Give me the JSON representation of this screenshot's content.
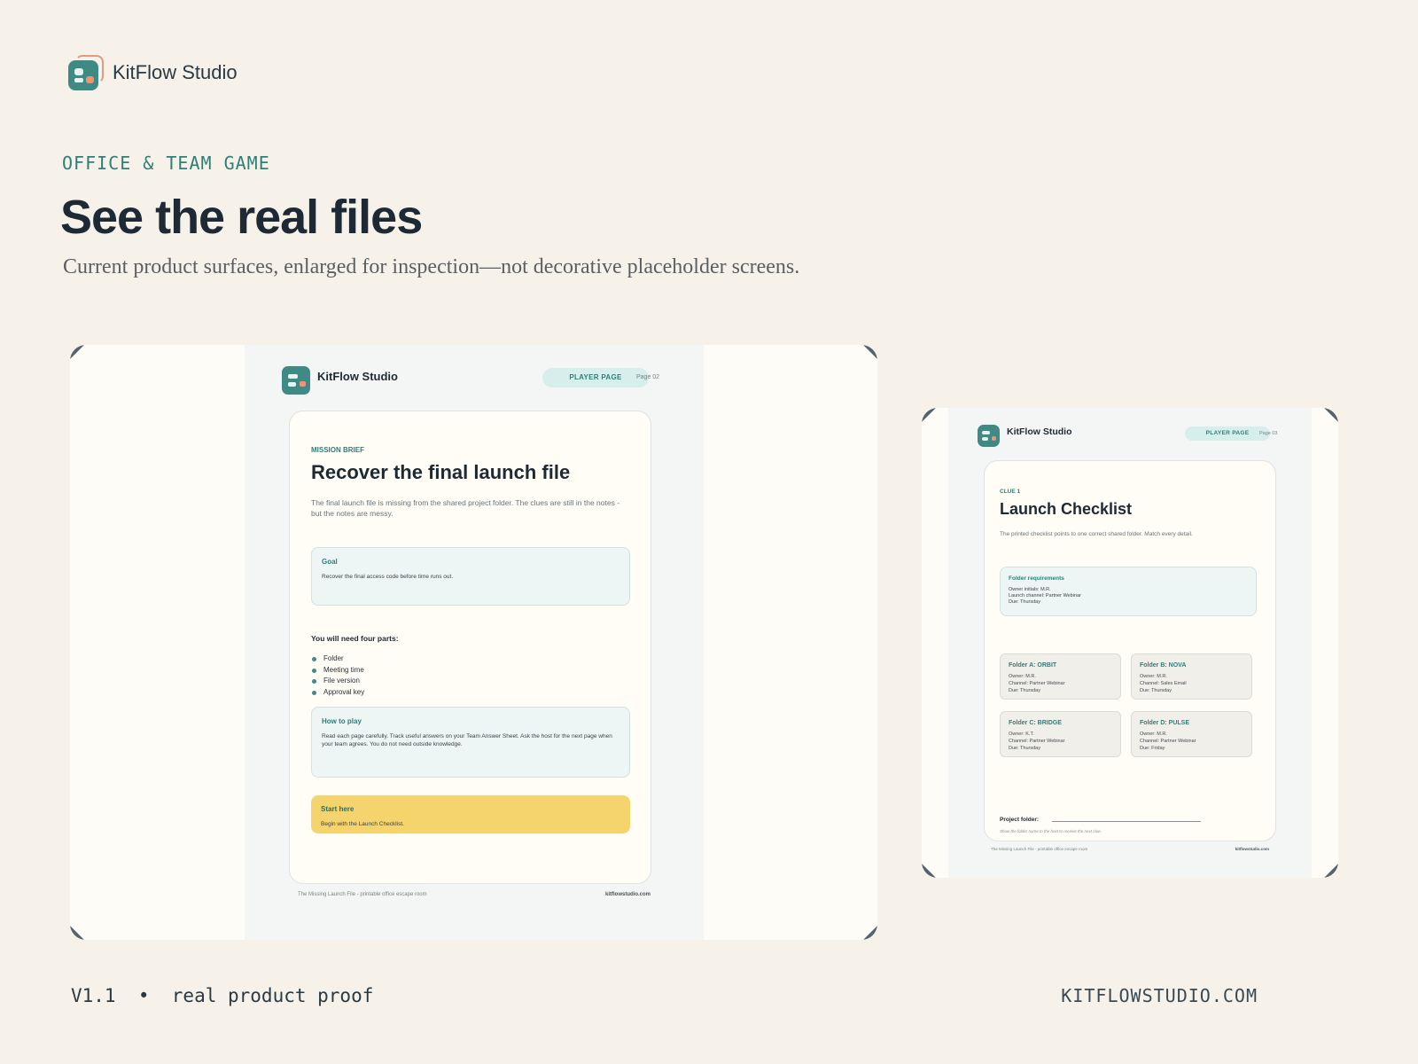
{
  "brand": {
    "name": "KitFlow Studio"
  },
  "eyebrow": "OFFICE & TEAM GAME",
  "headline": "See the real files",
  "subline": "Current product surfaces, enlarged for inspection—not decorative placeholder screens.",
  "page_a": {
    "brand": "KitFlow Studio",
    "pill": "PLAYER PAGE",
    "page_num": "Page 02",
    "kicker": "MISSION BRIEF",
    "title": "Recover the final launch file",
    "desc": "The final launch file is missing from the shared project folder. The clues are still in the notes - but the notes are messy.",
    "goal": {
      "label": "Goal",
      "text": "Recover the final access code before time runs out."
    },
    "parts_title": "You will need four parts:",
    "parts": [
      "Folder",
      "Meeting time",
      "File version",
      "Approval key"
    ],
    "how": {
      "label": "How to play",
      "text": "Read each page carefully. Track useful answers on your Team Answer Sheet. Ask the host for the next page when your team agrees. You do not need outside knowledge."
    },
    "start": {
      "label": "Start here",
      "text": "Begin with the Launch Checklist."
    },
    "footer_left": "The Missing Launch File - printable office escape room",
    "footer_right": "kitflowstudio.com"
  },
  "page_b": {
    "brand": "KitFlow Studio",
    "pill": "PLAYER PAGE",
    "page_num": "Page 03",
    "kicker": "CLUE 1",
    "title": "Launch Checklist",
    "desc": "The printed checklist points to one correct shared folder. Match every detail.",
    "req": {
      "label": "Folder requirements",
      "lines": [
        "Owner initials: M.R.",
        "Launch channel: Partner Webinar",
        "Due: Thursday"
      ]
    },
    "folders": [
      {
        "title": "Folder A: ORBIT",
        "lines": [
          "Owner: M.R.",
          "Channel: Partner Webinar",
          "Due: Thursday"
        ]
      },
      {
        "title": "Folder B: NOVA",
        "lines": [
          "Owner: M.R.",
          "Channel: Sales Email",
          "Due: Thursday"
        ]
      },
      {
        "title": "Folder C: BRIDGE",
        "lines": [
          "Owner: K.T.",
          "Channel: Partner Webinar",
          "Due: Thursday"
        ]
      },
      {
        "title": "Folder D: PULSE",
        "lines": [
          "Owner: M.R.",
          "Channel: Partner Webinar",
          "Due: Friday"
        ]
      }
    ],
    "project_label": "Project folder:",
    "project_hint": "Show the folder name to the host to receive the next clue.",
    "footer_left": "The Missing Launch File - printable office escape room",
    "footer_right": "kitflowstudio.com"
  },
  "footer": {
    "version": "V1.1  •  real product proof",
    "site": "KITFLOWSTUDIO.COM"
  },
  "colors": {
    "background": "#f6f2e9",
    "accent": "#3f8a84",
    "highlight": "#f6d46d",
    "logo_secondary": "#ec9476"
  },
  "icons": {
    "brand_logo": "kitflow-logo-icon",
    "bullet": "dot-icon"
  }
}
